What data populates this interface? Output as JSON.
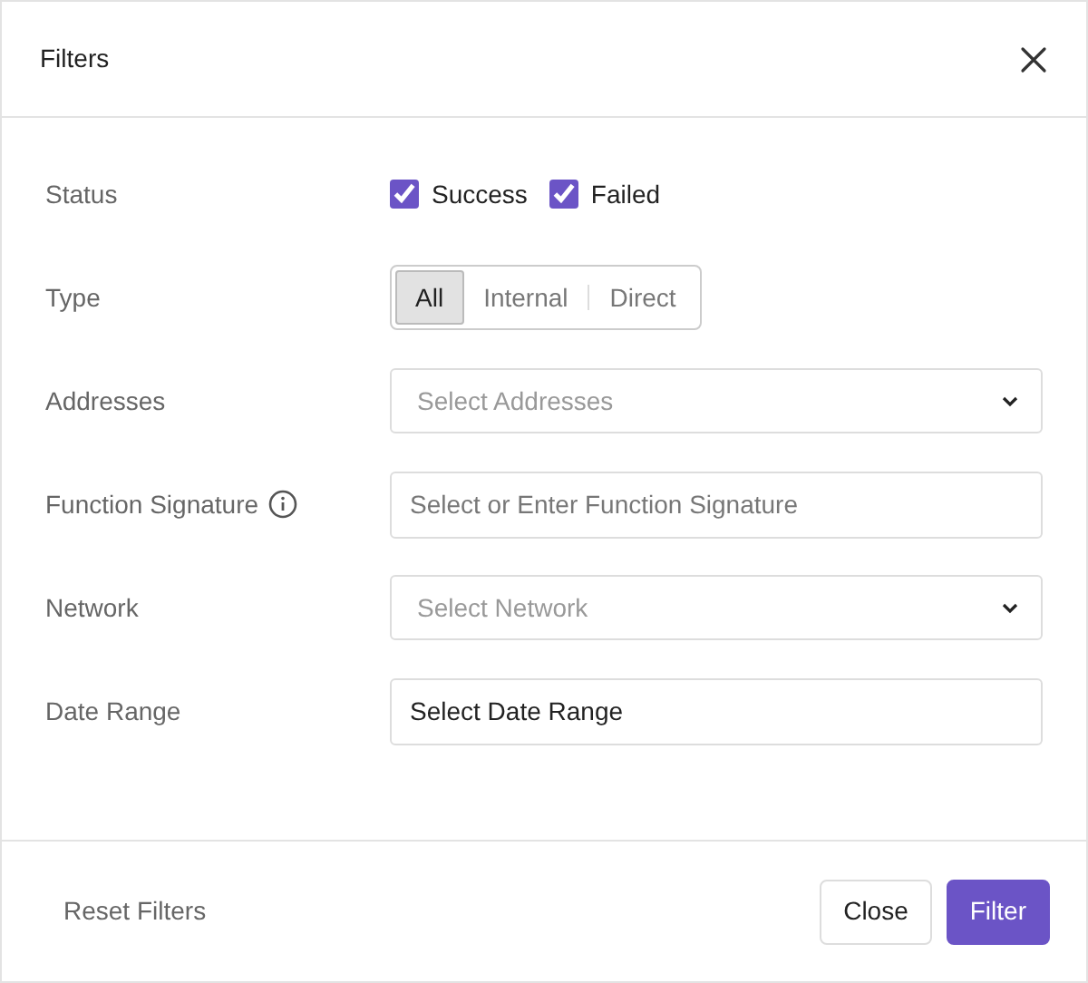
{
  "dialog": {
    "title": "Filters"
  },
  "fields": [
    {
      "label": "Status",
      "kind": "checkboxes",
      "options": [
        {
          "label": "Success",
          "checked": true
        },
        {
          "label": "Failed",
          "checked": true
        }
      ]
    },
    {
      "label": "Type",
      "kind": "segmented",
      "options": [
        {
          "label": "All",
          "selected": true
        },
        {
          "label": "Internal",
          "selected": false
        },
        {
          "label": "Direct",
          "selected": false
        }
      ]
    },
    {
      "label": "Addresses",
      "kind": "select",
      "placeholder": "Select Addresses"
    },
    {
      "label": "Function Signature",
      "info": true,
      "kind": "input",
      "placeholder": "Select or Enter Function Signature"
    },
    {
      "label": "Network",
      "kind": "select",
      "placeholder": "Select Network"
    },
    {
      "label": "Date Range",
      "kind": "input",
      "value": "Select Date Range"
    }
  ],
  "footer": {
    "reset": "Reset Filters",
    "buttons": [
      {
        "label": "Close",
        "kind": "secondary"
      },
      {
        "label": "Filter",
        "kind": "primary"
      }
    ]
  }
}
